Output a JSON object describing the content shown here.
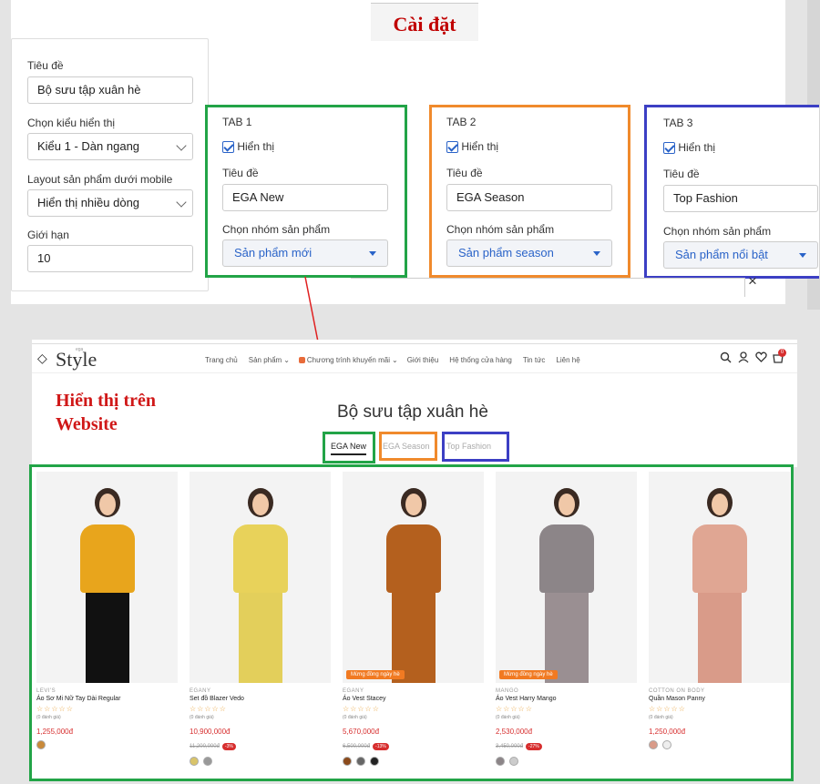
{
  "settings_title": "Cài đặt",
  "form": {
    "title_label": "Tiêu đề",
    "title_value": "Bộ sưu tập xuân hè",
    "display_label": "Chọn kiểu hiển thị",
    "display_value": "Kiểu 1 - Dàn ngang",
    "mobile_label": "Layout sản phẩm dưới mobile",
    "mobile_value": "Hiển thị nhiều dòng",
    "limit_label": "Giới hạn",
    "limit_value": "10"
  },
  "tabs": [
    {
      "heading": "TAB 1",
      "show": "Hiển thị",
      "title_label": "Tiêu đề",
      "title": "EGA New",
      "group_label": "Chọn nhóm sản phẩm",
      "group": "Sản phẩm mới",
      "border": "#22a447"
    },
    {
      "heading": "TAB 2",
      "show": "Hiển thị",
      "title_label": "Tiêu đề",
      "title": "EGA Season",
      "group_label": "Chọn nhóm sản phẩm",
      "group": "Sản phẩm season",
      "border": "#f08a2c"
    },
    {
      "heading": "TAB 3",
      "show": "Hiển thị",
      "title_label": "Tiêu đề",
      "title": "Top Fashion",
      "group_label": "Chọn nhóm sản phẩm",
      "group": "Sản phẩm nổi bật",
      "border": "#3c3fc4"
    }
  ],
  "close_icon": "×",
  "website_label": "Hiển thị trên Website",
  "site": {
    "logo_small": "ega",
    "logo": "Style",
    "nav": [
      "Trang chủ",
      "Sản phẩm",
      "Chương trình khuyến mãi",
      "Giới thiệu",
      "Hệ thống cửa hàng",
      "Tin tức",
      "Liên hệ"
    ],
    "cart_count": "0",
    "section_title": "Bộ sưu tập xuân hè",
    "tab_labels": [
      "EGA New",
      "EGA Season",
      "Top Fashion"
    ]
  },
  "products": [
    {
      "brand": "LEVI'S",
      "name": "Áo Sơ Mi Nữ Tay Dài Regular",
      "stars": "☆☆☆☆☆",
      "reviews": "(0 đánh giá)",
      "price": "1,255,000đ",
      "old": "",
      "discount": "",
      "badge": "",
      "top": "#e8a51c",
      "bottom": "#111",
      "swatches": [
        "#c98a3a"
      ]
    },
    {
      "brand": "EGANY",
      "name": "Set đồ Blazer Vedo",
      "stars": "☆☆☆☆☆",
      "reviews": "(0 đánh giá)",
      "price": "10,900,000đ",
      "old": "11,200,000đ",
      "discount": "-3%",
      "badge": "",
      "top": "#e8d25a",
      "bottom": "#e3cf5b",
      "swatches": [
        "#d9c46a",
        "#999"
      ]
    },
    {
      "brand": "EGANY",
      "name": "Áo Vest Stacey",
      "stars": "☆☆☆☆☆",
      "reviews": "(0 đánh giá)",
      "price": "5,670,000đ",
      "old": "6,500,000đ",
      "discount": "-13%",
      "badge": "Mừng đồng ngày hè",
      "top": "#b4601e",
      "bottom": "#b4601e",
      "swatches": [
        "#8b4a1b",
        "#666",
        "#222"
      ]
    },
    {
      "brand": "MANGO",
      "name": "Áo Vest Harry Mango",
      "stars": "☆☆☆☆☆",
      "reviews": "(0 đánh giá)",
      "price": "2,530,000đ",
      "old": "3,450,000đ",
      "discount": "-27%",
      "badge": "Mừng đồng ngày hè",
      "top": "#8c8588",
      "bottom": "#9a8f92",
      "swatches": [
        "#8c8588",
        "#ccc"
      ]
    },
    {
      "brand": "COTTON ON BODY",
      "name": "Quần Mason Panny",
      "stars": "☆☆☆☆☆",
      "reviews": "(0 đánh giá)",
      "price": "1,250,000đ",
      "old": "",
      "discount": "",
      "badge": "",
      "top": "#e0a693",
      "bottom": "#d99b89",
      "swatches": [
        "#d99b89",
        "#eee"
      ]
    }
  ]
}
